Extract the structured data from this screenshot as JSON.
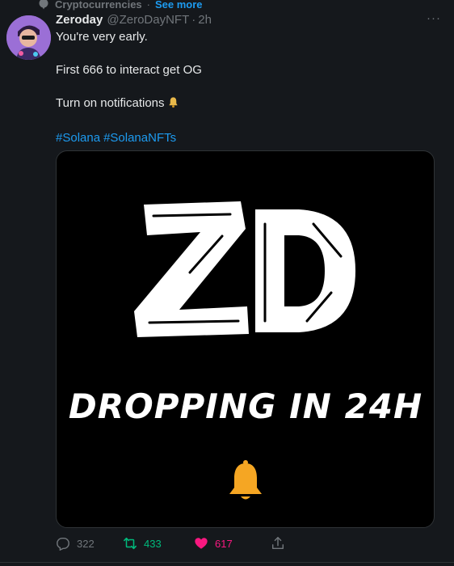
{
  "context": {
    "topic": "Cryptocurrencies",
    "separator": "·",
    "see_more": "See more"
  },
  "author": {
    "name": "Zeroday",
    "handle": "@ZeroDayNFT",
    "separator": "·",
    "time": "2h"
  },
  "more_label": "···",
  "body": {
    "line1": "You're very early.",
    "line2": "First 666 to interact get OG",
    "line3": "Turn on notifications"
  },
  "hashtags": [
    "#Solana",
    "#SolanaNFTs"
  ],
  "media": {
    "logo": "ZD",
    "tagline": "DROPPING IN 24H",
    "bell_icon": "bell-icon"
  },
  "actions": {
    "replies": "322",
    "retweets": "433",
    "likes": "617"
  },
  "colors": {
    "background": "#15181c",
    "accent": "#1d9bf0",
    "retweet": "#00ba7c",
    "like": "#f91880",
    "bell": "#f5a623"
  }
}
